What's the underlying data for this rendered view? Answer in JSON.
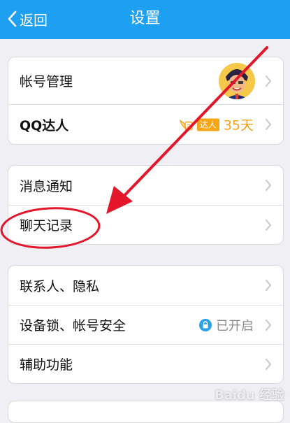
{
  "header": {
    "back_label": "返回",
    "title": "设置"
  },
  "groups": [
    {
      "rows": [
        {
          "label": "帐号管理"
        },
        {
          "label": "QQ达人",
          "badge_text": "达人",
          "days": "35天"
        }
      ]
    },
    {
      "rows": [
        {
          "label": "消息通知"
        },
        {
          "label": "聊天记录"
        }
      ]
    },
    {
      "rows": [
        {
          "label": "联系人、隐私"
        },
        {
          "label": "设备锁、帐号安全",
          "status": "已开启"
        },
        {
          "label": "辅助功能"
        }
      ]
    }
  ],
  "watermark": "Baidu 经验",
  "colors": {
    "header_bg": "#1ea0f2",
    "annotation_red": "#e3162b",
    "badge_orange": "#f6a515",
    "status_blue": "#2ba2e8"
  },
  "icons": [
    "chevron-left-icon",
    "chevron-right-icon",
    "lock-icon",
    "wings-icon",
    "avatar"
  ]
}
